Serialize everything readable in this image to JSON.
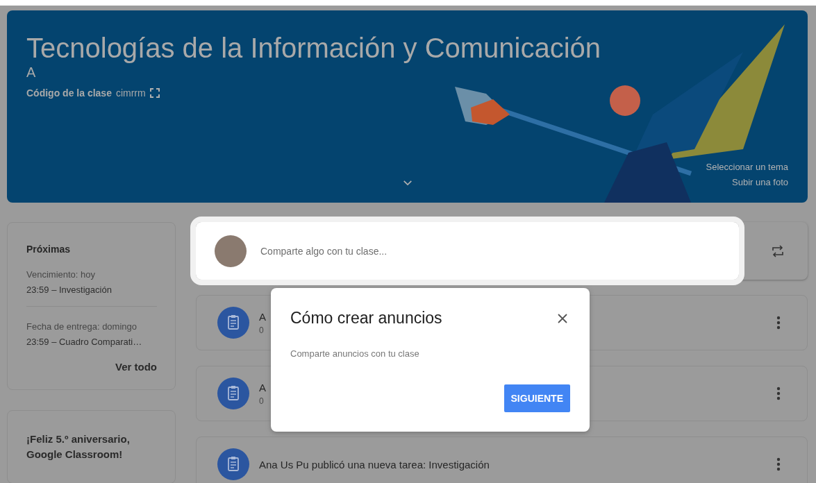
{
  "banner": {
    "title": "Tecnologías de la Información y Comunicación",
    "section": "A",
    "class_code_label": "Código de la clase",
    "class_code": "cimrrm",
    "links": [
      "Seleccionar un tema",
      "Subir una foto"
    ]
  },
  "sidebar": {
    "upcoming": {
      "title": "Próximas",
      "items": [
        {
          "due": "Vencimiento: hoy",
          "detail": "23:59 – Investigación"
        },
        {
          "due": "Fecha de entrega: domingo",
          "detail": "23:59 – Cuadro Comparati…"
        }
      ],
      "view_all": "Ver todo"
    },
    "anniversary": {
      "title": "¡Feliz 5.º aniversario, Google Classroom!"
    }
  },
  "composer": {
    "placeholder": "Comparte algo con tu clase..."
  },
  "stream": [
    {
      "title": "A",
      "date": "0"
    },
    {
      "title": "A",
      "date": "0"
    },
    {
      "title": "Ana Us Pu publicó una nueva tarea: Investigación"
    }
  ],
  "dialog": {
    "title": "Cómo crear anuncios",
    "text": "Comparte anuncios con tu clase",
    "button": "SIGUIENTE"
  }
}
